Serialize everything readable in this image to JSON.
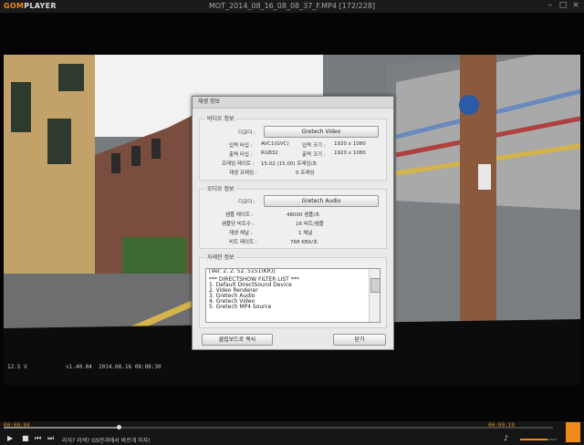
{
  "app": {
    "logo_text_a": "GOM",
    "logo_text_b": "PLAYER",
    "window_title": "MOT_2014_08_16_08_08_37_F.MP4  [172/228]"
  },
  "osd": {
    "voltage": "12.5 V",
    "version": "v1.40.04",
    "datetime": "2014.08.16 08:08:30"
  },
  "dialog": {
    "title": "재생 정보",
    "video": {
      "label": "비디오 정보",
      "decoder_label": "디코더 :",
      "decoder_button": "Gretech Video",
      "input_type_label": "입력 타입 :",
      "input_type": "AVC1(GVC)",
      "input_size_label": "입력 크기 :",
      "input_size": "1920 x 1080",
      "output_type_label": "출력 타입 :",
      "output_type": "RGB32",
      "output_size_label": "출력 크기 :",
      "output_size": "1920 x 1080",
      "framerate_label": "프레임 레이트 :",
      "framerate": "15.02 (15.00) 프레임/초",
      "dropped_label": "재생 프레임 :",
      "dropped": "0 프레임"
    },
    "audio": {
      "label": "오디오 정보",
      "decoder_label": "디코더 :",
      "decoder_button": "Gretech Audio",
      "samplerate_label": "샘플 레이트 :",
      "samplerate": "48000 샘플/초",
      "bits_label": "샘플당 비트수 :",
      "bits": "16 비트/샘플",
      "channels_label": "재생 채널 :",
      "channels": "1 채널",
      "bitrate_label": "비트 레이트 :",
      "bitrate": "768 KBit/초"
    },
    "detail": {
      "label": "자세한 정보",
      "lines": [
        "[Ver. 2. 2. 52. 5151(KR)]",
        "",
        "*** DIRECTSHOW FILTER LIST ***",
        "1. Default DirectSound Device",
        "2. Video Renderer",
        "3. Gretech Audio",
        "4. Gretech Video",
        "5. Gretech MP4 Source"
      ]
    },
    "copy_button": "클립보드로 복사",
    "close_button": "닫기"
  },
  "player": {
    "elapsed": "00:00:04",
    "total": "00:00:19",
    "progress": 0.21,
    "marquee": "라식? 라섹? GS안과에서 바르게 하자!",
    "colors": {
      "accent": "#f08a1c"
    }
  }
}
